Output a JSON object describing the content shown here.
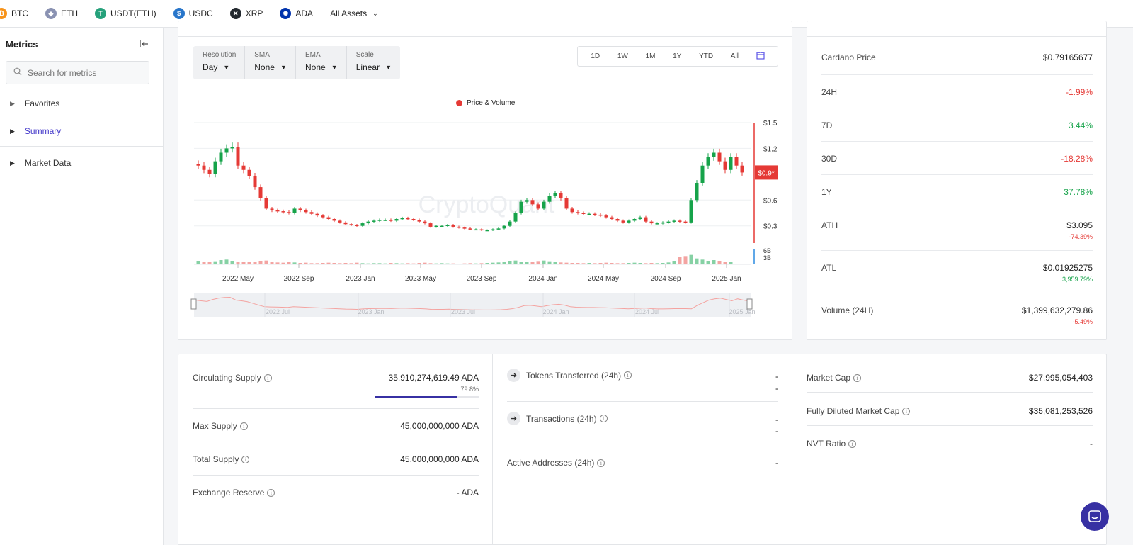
{
  "assets": [
    {
      "label": "BTC",
      "color": "#f7931a",
      "glyph": "₿"
    },
    {
      "label": "ETH",
      "color": "#8a92b2",
      "glyph": "◆"
    },
    {
      "label": "USDT(ETH)",
      "color": "#26a17b",
      "glyph": "T"
    },
    {
      "label": "USDC",
      "color": "#2775ca",
      "glyph": "$"
    },
    {
      "label": "XRP",
      "color": "#23292f",
      "glyph": "✕"
    },
    {
      "label": "ADA",
      "color": "#0033ad",
      "glyph": "✺"
    }
  ],
  "all_assets_label": "All Assets",
  "sidebar": {
    "title": "Metrics",
    "search_placeholder": "Search for metrics",
    "items": [
      {
        "label": "Favorites"
      },
      {
        "label": "Summary"
      },
      {
        "label": "Market Data"
      }
    ]
  },
  "controls": [
    {
      "label": "Resolution",
      "value": "Day"
    },
    {
      "label": "SMA",
      "value": "None"
    },
    {
      "label": "EMA",
      "value": "None"
    },
    {
      "label": "Scale",
      "value": "Linear"
    }
  ],
  "ranges": [
    "1D",
    "1W",
    "1M",
    "1Y",
    "YTD",
    "All"
  ],
  "chart_data": {
    "type": "candlestick",
    "legend": "Price & Volume",
    "watermark": "CryptoQuant",
    "y_ticks": [
      "$1.5",
      "$1.2",
      "$0.6",
      "$0.3"
    ],
    "y_values": [
      1.5,
      1.2,
      0.6,
      0.3
    ],
    "ylim": [
      0.1,
      1.5
    ],
    "current_price_label": "$0.9*",
    "current_price": 0.92,
    "volume_ticks": [
      "6B",
      "3B"
    ],
    "x_ticks": [
      "2022 May",
      "2022 Sep",
      "2023 Jan",
      "2023 May",
      "2023 Sep",
      "2024 Jan",
      "2024 May",
      "2024 Sep",
      "2025 Jan"
    ],
    "navigator_ticks": [
      "2022 Jul",
      "2023 Jan",
      "2023 Jul",
      "2024 Jan",
      "2024 Jul",
      "2025 Jan"
    ],
    "close_series": [
      1.0,
      0.95,
      0.9,
      1.05,
      1.15,
      1.2,
      1.22,
      1.0,
      0.95,
      0.88,
      0.75,
      0.62,
      0.5,
      0.48,
      0.47,
      0.46,
      0.45,
      0.5,
      0.48,
      0.46,
      0.44,
      0.42,
      0.4,
      0.38,
      0.36,
      0.34,
      0.32,
      0.31,
      0.3,
      0.33,
      0.35,
      0.36,
      0.37,
      0.37,
      0.36,
      0.38,
      0.39,
      0.38,
      0.37,
      0.35,
      0.33,
      0.29,
      0.3,
      0.3,
      0.31,
      0.29,
      0.28,
      0.27,
      0.26,
      0.26,
      0.25,
      0.25,
      0.26,
      0.27,
      0.3,
      0.35,
      0.45,
      0.58,
      0.6,
      0.55,
      0.5,
      0.58,
      0.65,
      0.68,
      0.62,
      0.5,
      0.46,
      0.45,
      0.44,
      0.44,
      0.43,
      0.42,
      0.4,
      0.38,
      0.36,
      0.34,
      0.36,
      0.38,
      0.4,
      0.35,
      0.33,
      0.33,
      0.34,
      0.35,
      0.36,
      0.35,
      0.34,
      0.6,
      0.8,
      1.0,
      1.1,
      1.15,
      1.05,
      0.95,
      1.1,
      1.0,
      0.92
    ],
    "volume_series": [
      1.5,
      1.2,
      1.0,
      1.3,
      1.8,
      2.0,
      1.5,
      1.1,
      1.0,
      0.9,
      1.2,
      1.5,
      1.6,
      1.0,
      0.8,
      0.7,
      0.9,
      0.8,
      0.6,
      0.7,
      0.5,
      0.5,
      0.6,
      0.7,
      0.6,
      0.5,
      0.6,
      0.5,
      0.7,
      0.5,
      0.4,
      0.5,
      0.5,
      0.4,
      0.6,
      0.5,
      0.4,
      0.5,
      0.4,
      0.6,
      0.7,
      0.5,
      0.4,
      0.5,
      0.4,
      0.4,
      0.3,
      0.4,
      0.5,
      0.4,
      0.5,
      0.6,
      0.7,
      0.8,
      1.2,
      1.5,
      1.6,
      1.2,
      1.0,
      1.1,
      1.4,
      1.6,
      1.3,
      1.0,
      0.8,
      0.7,
      0.6,
      0.6,
      0.5,
      0.6,
      0.5,
      0.6,
      0.7,
      0.6,
      0.5,
      0.5,
      0.6,
      0.7,
      0.6,
      0.5,
      0.6,
      0.5,
      0.6,
      0.8,
      1.5,
      3.0,
      3.5,
      4.0,
      2.5,
      2.0,
      1.5,
      1.8,
      1.5,
      1.0,
      1.2
    ]
  },
  "stats": {
    "price_label": "Cardano Price",
    "price_value": "$0.79165677",
    "rows": [
      {
        "label": "24H",
        "value": "-1.99%",
        "tone": "red"
      },
      {
        "label": "7D",
        "value": "3.44%",
        "tone": "green"
      },
      {
        "label": "30D",
        "value": "-18.28%",
        "tone": "red"
      },
      {
        "label": "1Y",
        "value": "37.78%",
        "tone": "green"
      }
    ],
    "ath_label": "ATH",
    "ath_value": "$3.095",
    "ath_change": "-74.39%",
    "atl_label": "ATL",
    "atl_value": "$0.01925275",
    "atl_change": "3,959.79%",
    "volume_label": "Volume (24H)",
    "volume_value": "$1,399,632,279.86",
    "volume_change": "-5.49%"
  },
  "supply": {
    "circulating_label": "Circulating Supply",
    "circulating_value": "35,910,274,619.49 ADA",
    "circulating_pct": "79.8%",
    "circulating_fraction": 0.798,
    "max_label": "Max Supply",
    "max_value": "45,000,000,000 ADA",
    "total_label": "Total Supply",
    "total_value": "45,000,000,000 ADA",
    "reserve_label": "Exchange Reserve",
    "reserve_value": "- ADA"
  },
  "activity": {
    "tokens_label": "Tokens Transferred (24h)",
    "tokens_value": "-",
    "tokens_sub": "-",
    "tx_label": "Transactions (24h)",
    "tx_value": "-",
    "tx_sub": "-",
    "addresses_label": "Active Addresses (24h)",
    "addresses_value": "-"
  },
  "market": {
    "cap_label": "Market Cap",
    "cap_value": "$27,995,054,403",
    "fdv_label": "Fully Diluted Market Cap",
    "fdv_value": "$35,081,253,526",
    "nvt_label": "NVT Ratio",
    "nvt_value": "-"
  },
  "colors": {
    "up": "#16a34a",
    "down": "#e53935",
    "accent": "#3730a3"
  }
}
